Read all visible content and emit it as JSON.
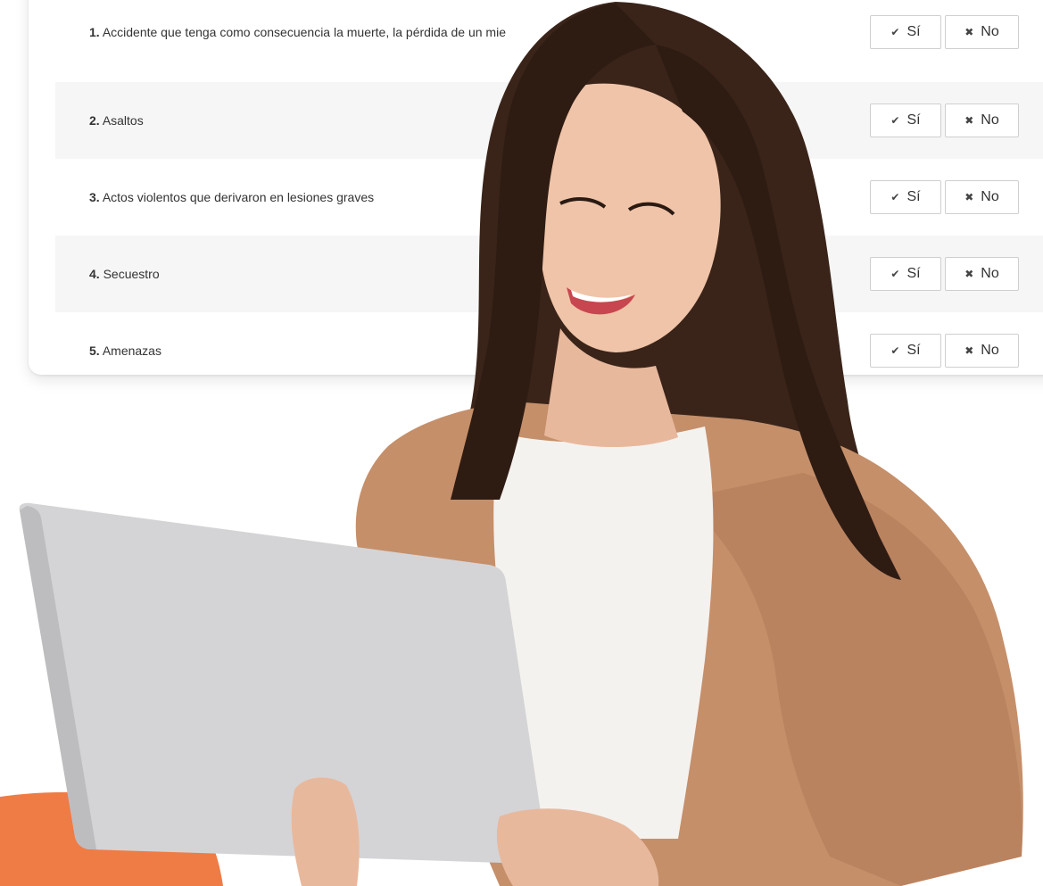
{
  "survey": {
    "questions": [
      {
        "number": "1.",
        "text": "Accidente que tenga como consecuencia la muerte, la pérdida de un mie"
      },
      {
        "number": "2.",
        "text": "Asaltos"
      },
      {
        "number": "3.",
        "text": "Actos violentos que derivaron en lesiones graves"
      },
      {
        "number": "4.",
        "text": "Secuestro"
      },
      {
        "number": "5.",
        "text": "Amenazas"
      }
    ],
    "yes_label": "Sí",
    "no_label": "No",
    "yes_icon": "check-icon",
    "no_icon": "x-icon"
  },
  "colors": {
    "accent_orange": "#ef7b45",
    "row_shade": "#f6f6f6",
    "sweater": "#c58f6a",
    "hair": "#3a2419",
    "laptop": "#d4d4d6"
  }
}
